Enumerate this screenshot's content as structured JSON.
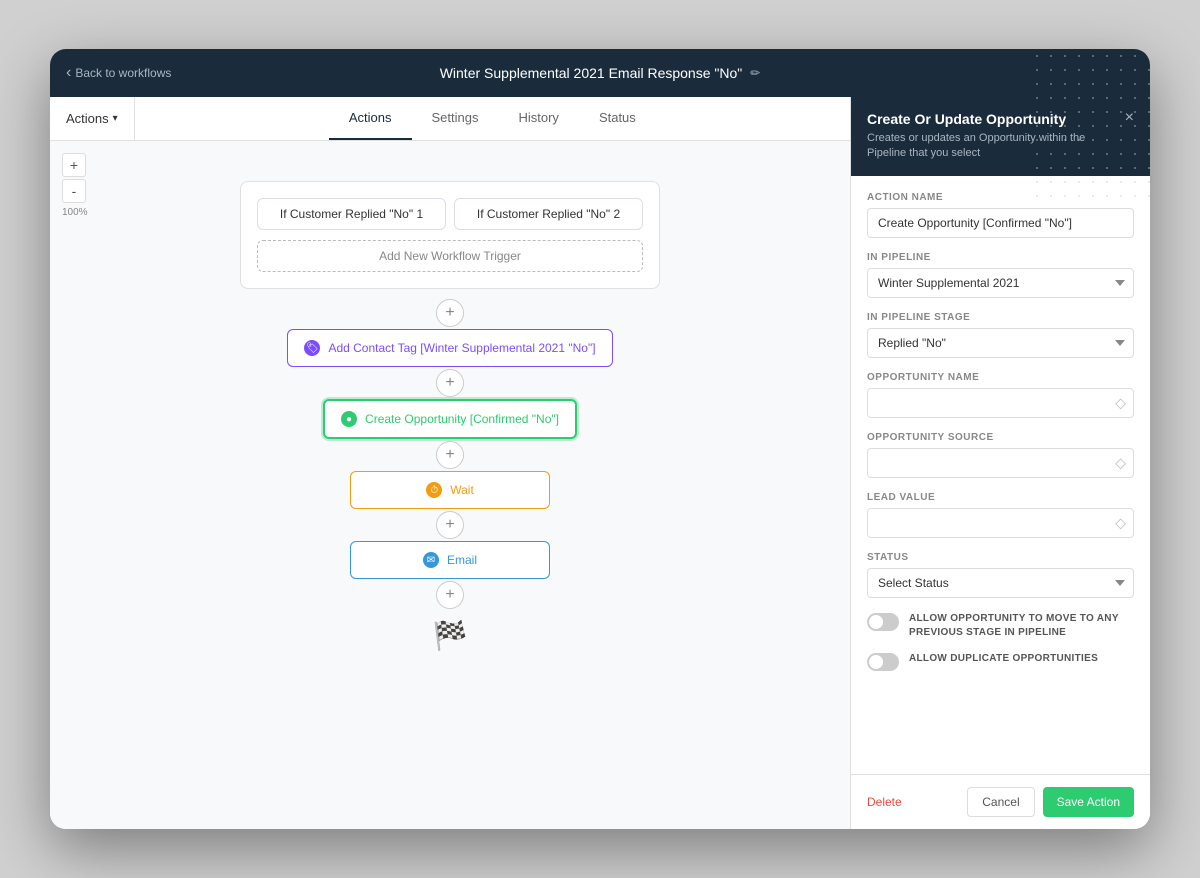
{
  "app": {
    "back_label": "Back to workflows",
    "workflow_title": "Winter Supplemental 2021 Email Response \"No\"",
    "edit_icon": "✏"
  },
  "tabs": {
    "actions_dropdown": "Actions",
    "items": [
      {
        "id": "actions",
        "label": "Actions",
        "active": true
      },
      {
        "id": "settings",
        "label": "Settings",
        "active": false
      },
      {
        "id": "history",
        "label": "History",
        "active": false
      },
      {
        "id": "status",
        "label": "Status",
        "active": false
      }
    ]
  },
  "canvas": {
    "zoom_level": "100%",
    "zoom_in": "+",
    "zoom_out": "-",
    "trigger_nodes": [
      {
        "label": "If Customer Replied \"No\" 1"
      },
      {
        "label": "If Customer Replied \"No\" 2"
      }
    ],
    "add_trigger_label": "Add New Workflow Trigger",
    "action_nodes": [
      {
        "id": "tag",
        "type": "tag",
        "label": "Add Contact Tag [Winter Supplemental 2021 \"No\"]",
        "icon": "🏷"
      },
      {
        "id": "opportunity",
        "type": "opportunity",
        "label": "Create Opportunity [Confirmed \"No\"]",
        "icon": "●",
        "active": true
      },
      {
        "id": "wait",
        "type": "wait",
        "label": "Wait",
        "icon": "●"
      },
      {
        "id": "email",
        "type": "email",
        "label": "Email",
        "icon": "✉"
      }
    ],
    "connector_icon": "+",
    "finish_flag": "🏁"
  },
  "right_panel": {
    "title": "Create Or Update Opportunity",
    "subtitle": "Creates or updates an Opportunity within the Pipeline that you select",
    "close_icon": "×",
    "fields": {
      "action_name": {
        "label": "ACTION NAME",
        "value": "Create Opportunity [Confirmed \"No\"]"
      },
      "in_pipeline": {
        "label": "IN PIPELINE",
        "value": "Winter Supplemental 2021",
        "options": [
          "Winter Supplemental 2021"
        ]
      },
      "in_pipeline_stage": {
        "label": "IN PIPELINE STAGE",
        "value": "Replied \"No\"",
        "options": [
          "Replied \"No\""
        ]
      },
      "opportunity_name": {
        "label": "OPPORTUNITY NAME",
        "value": "",
        "placeholder": ""
      },
      "opportunity_source": {
        "label": "OPPORTUNITY SOURCE",
        "value": "",
        "placeholder": ""
      },
      "lead_value": {
        "label": "LEAD VALUE",
        "value": "",
        "placeholder": ""
      },
      "status": {
        "label": "STATUS",
        "value": "Select Status",
        "options": [
          "Select Status"
        ]
      }
    },
    "toggles": [
      {
        "id": "allow-previous",
        "label": "ALLOW OPPORTUNITY TO MOVE TO ANY PREVIOUS STAGE IN PIPELINE"
      },
      {
        "id": "allow-duplicate",
        "label": "ALLOW DUPLICATE OPPORTUNITIES"
      }
    ],
    "footer": {
      "delete_label": "Delete",
      "cancel_label": "Cancel",
      "save_label": "Save Action"
    }
  }
}
